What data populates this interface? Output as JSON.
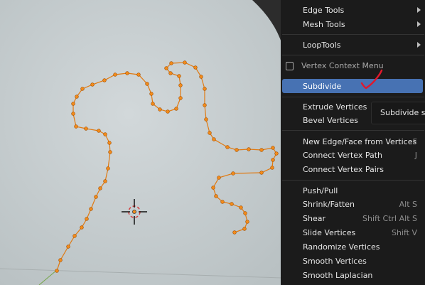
{
  "menu": {
    "edge_tools": "Edge Tools",
    "mesh_tools": "Mesh Tools",
    "loop_tools": "LoopTools",
    "context_header": "Vertex Context Menu",
    "subdivide": "Subdivide",
    "extrude_vertices": "Extrude Vertices",
    "bevel_vertices": "Bevel Vertices",
    "new_edge_face": "New Edge/Face from Vertices",
    "new_edge_face_shortcut": "F",
    "connect_vertex_path": "Connect Vertex Path",
    "connect_vertex_path_shortcut": "J",
    "connect_vertex_pairs": "Connect Vertex Pairs",
    "push_pull": "Push/Pull",
    "shrink_fatten": "Shrink/Fatten",
    "shrink_fatten_shortcut": "Alt S",
    "shear": "Shear",
    "shear_shortcut": "Shift Ctrl Alt S",
    "slide_vertices": "Slide Vertices",
    "slide_vertices_shortcut": "Shift V",
    "randomize_vertices": "Randomize Vertices",
    "smooth_vertices": "Smooth Vertices",
    "smooth_laplacian": "Smooth Laplacian"
  },
  "tooltip": {
    "text": "Subdivide se"
  },
  "colors": {
    "accent": "#4772b3",
    "vertex": "#f28b1b",
    "edge": "#e07a12",
    "annotation": "#e0182c",
    "menu_bg": "#1b1b1b"
  }
}
